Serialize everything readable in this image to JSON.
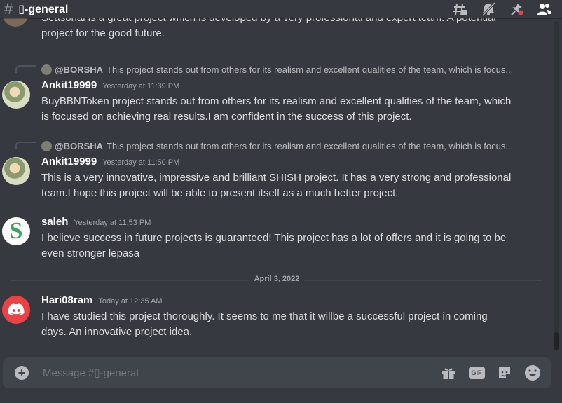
{
  "header": {
    "hash_symbol": "#",
    "channel_name": "▯-general"
  },
  "top_fragment": {
    "line1": "Seasonal is a great project which is developed by a very professional and expert team. A potential",
    "line2": "project for the good future."
  },
  "messages": [
    {
      "reply_author": "@BORSHA",
      "reply_text": "This project stands out from others for its realism and excellent qualities of the team, which is focus...",
      "author": "Ankit19999",
      "timestamp": "Yesterday at 11:39 PM",
      "line1": "BuyBBNToken project stands out from others for its realism and excellent qualities of the team, which",
      "line2": "is focused on achieving real results.I am confident in the success of this project."
    },
    {
      "reply_author": "@BORSHA",
      "reply_text": "This project stands out from others for its realism and excellent qualities of the team, which is focus...",
      "author": "Ankit19999",
      "timestamp": "Yesterday at 11:50 PM",
      "line1": "This is a very innovative, impressive and brilliant SHISH  project. It has a very strong and professional",
      "line2": "team.I hope this project will be able to present itself as a much better project."
    },
    {
      "author": "saleh",
      "timestamp": "Yesterday at 11:53 PM",
      "line1": "I believe success in future projects is guaranteed!  This project has a lot of offers and it is going to be",
      "line2": "even stronger lepasa"
    },
    {
      "author": "Hari08ram",
      "timestamp": "Today at 12:35 AM",
      "line1": "I have studied this project thoroughly. It seems to me that it willbe a successful project in coming",
      "line2": "days. An innovative project idea."
    }
  ],
  "date_divider": "April 3, 2022",
  "composer": {
    "placeholder": "Message #▯-general",
    "gif_label": "GIF"
  },
  "avatar_letters": {
    "saleh": "S"
  },
  "icons": {
    "threads": "threads-icon",
    "mute": "bell-muted-icon",
    "pin": "pin-icon",
    "members": "members-icon",
    "add": "plus-circle-icon",
    "gift": "gift-icon",
    "gif": "gif-icon",
    "sticker": "sticker-icon",
    "emoji": "emoji-icon"
  },
  "colors": {
    "background": "#36393f",
    "composer": "#40444b",
    "hari_avatar": "#ed4245",
    "saleh_letter": "#3ba55c"
  }
}
